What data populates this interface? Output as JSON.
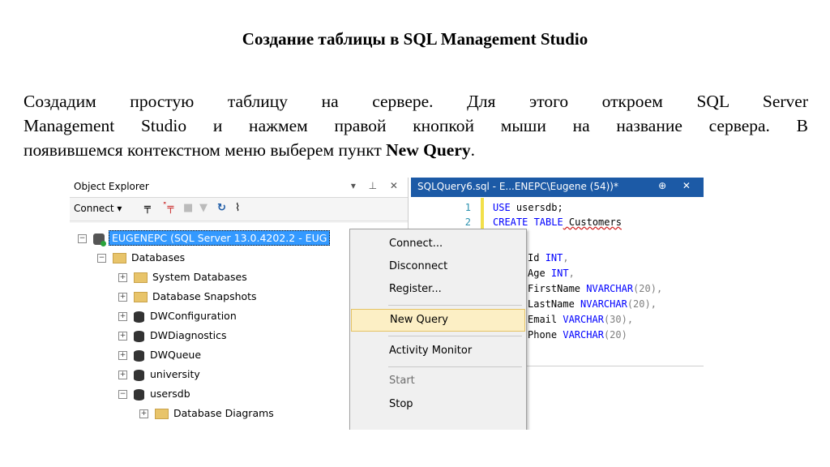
{
  "slide": {
    "title": "Создание таблицы в SQL Management Studio",
    "para_lines": [
      "Создадим простую таблицу на сервере. Для этого откроем SQL Server",
      "Management Studio и нажмем правой кнопкой мыши на название сервера. В",
      "появившемся контекстном меню выберем пункт "
    ],
    "para_bold": "New Query",
    "para_end": "."
  },
  "object_explorer": {
    "title": "Object Explorer",
    "header_icons": "▾ ⊥ ✕",
    "toolbar": {
      "connect_label": "Connect ▾"
    },
    "server_label": "EUGENEPC (SQL Server 13.0.4202.2 - EUG",
    "nodes": [
      {
        "label": "Databases"
      },
      {
        "label": "System Databases"
      },
      {
        "label": "Database Snapshots"
      },
      {
        "label": "DWConfiguration"
      },
      {
        "label": "DWDiagnostics"
      },
      {
        "label": "DWQueue"
      },
      {
        "label": "university"
      },
      {
        "label": "usersdb"
      },
      {
        "label": "Database Diagrams"
      }
    ]
  },
  "context_menu": {
    "items": [
      {
        "label": "Connect..."
      },
      {
        "label": "Disconnect"
      },
      {
        "label": "Register..."
      },
      {
        "label": "New Query",
        "selected": true
      },
      {
        "label": "Activity Monitor"
      },
      {
        "label": "Start"
      },
      {
        "label": "Stop"
      }
    ]
  },
  "editor": {
    "tab_title": "SQLQuery6.sql - E...ENEPC\\Eugene (54))*",
    "tab_icons": "⊕ ✕",
    "line_numbers": [
      "1",
      "2"
    ],
    "lines": [
      {
        "kw": "USE",
        "rest": " usersdb;"
      },
      {
        "kw": "CREATE TABLE",
        "rest": " Customers"
      },
      {
        "name": "Id",
        "type": "INT",
        "tail": ","
      },
      {
        "name": "Age",
        "type": "INT",
        "tail": ","
      },
      {
        "name": "FirstName",
        "type": "NVARCHAR",
        "size": "(20)",
        "tail": ","
      },
      {
        "name": "LastName",
        "type": "NVARCHAR",
        "size": "(20)",
        "tail": ","
      },
      {
        "name": "Email",
        "type": "VARCHAR",
        "size": "(30)",
        "tail": ","
      },
      {
        "name": "Phone",
        "type": "VARCHAR",
        "size": "(20)",
        "tail": ""
      }
    ]
  },
  "colors": {
    "editor_tab": "#1c5aa6",
    "selection": "#3399ff",
    "menu_highlight": "#fcefc5",
    "keyword": "#0000ff"
  }
}
